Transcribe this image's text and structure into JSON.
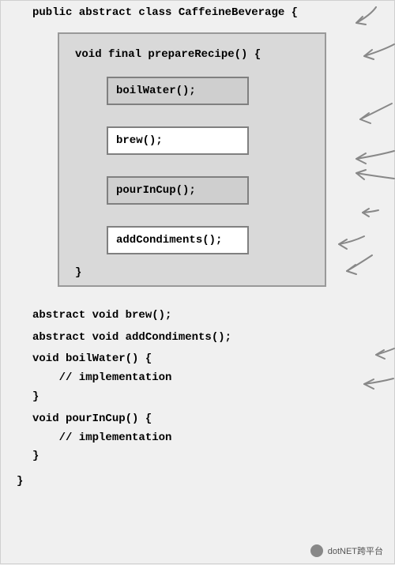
{
  "class_decl": "public abstract class CaffeineBeverage {",
  "block": {
    "signature": "void final prepareRecipe() {",
    "steps": [
      {
        "text": "boilWater();",
        "style": "grey"
      },
      {
        "text": "brew();",
        "style": "white"
      },
      {
        "text": "pourInCup();",
        "style": "grey"
      },
      {
        "text": "addCondiments();",
        "style": "white"
      }
    ],
    "close": "}"
  },
  "methods": {
    "brew": "abstract void brew();",
    "addCondiments": "abstract void addCondiments();",
    "boilWater_sig": "void boilWater() {",
    "impl_comment": "    // implementation",
    "close": "}",
    "pourInCup_sig": "void pourInCup() {"
  },
  "class_close": "}",
  "footer": "dotNET跨平台"
}
